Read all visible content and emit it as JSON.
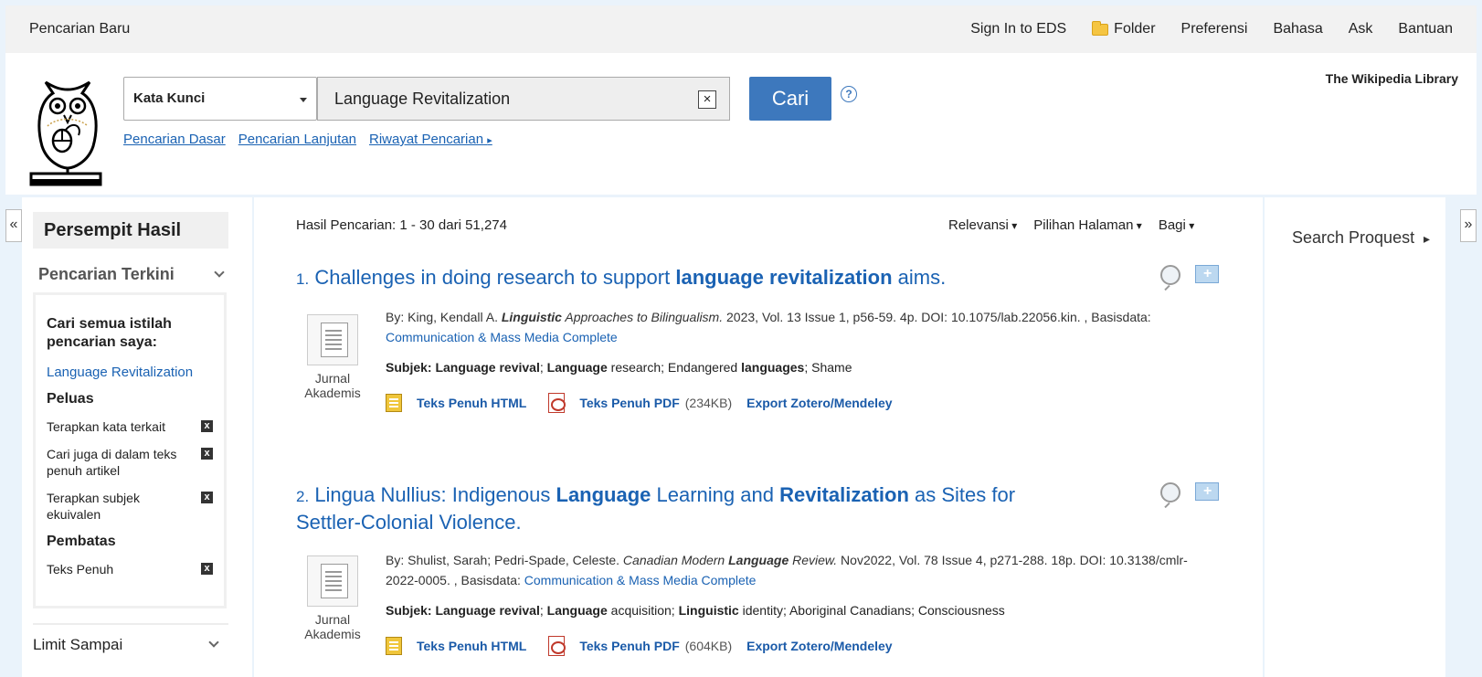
{
  "topbar": {
    "new_search": "Pencarian Baru",
    "sign_in": "Sign In to EDS",
    "folder": "Folder",
    "preferences": "Preferensi",
    "language": "Bahasa",
    "ask": "Ask",
    "help": "Bantuan"
  },
  "header": {
    "field_select": "Kata Kunci",
    "query": "Language Revitalization",
    "clear_icon": "close-icon",
    "search_button": "Cari",
    "help_icon": "?",
    "links": [
      "Pencarian Dasar",
      "Pencarian Lanjutan",
      "Riwayat Pencarian"
    ],
    "institution": "The Wikipedia Library"
  },
  "sidebar": {
    "collapse": "«",
    "title": "Persempit Hasil",
    "recent": "Pencarian Terkini",
    "search_all": "Cari semua istilah pencarian saya:",
    "recent_term": "Language Revitalization",
    "expanders_title": "Peluas",
    "expanders": [
      "Terapkan kata terkait",
      "Cari juga di dalam teks penuh artikel",
      "Terapkan subjek ekuivalen"
    ],
    "limiters_title": "Pembatas",
    "limiters": [
      "Teks Penuh"
    ],
    "remove_icon": "x",
    "limit_to": "Limit Sampai"
  },
  "results": {
    "count": "Hasil Pencarian: 1 - 30 dari 51,274",
    "sort": "Relevansi",
    "page_options": "Pilihan Halaman",
    "share": "Bagi",
    "items": [
      {
        "num": "1.",
        "title_a": "Challenges in doing research to support ",
        "title_b": "language revitalization",
        "title_c": " aims.",
        "by": "By: King, Kendall A. ",
        "src_b": "Linguistic",
        "src_rest": " Approaches to Bilingualism.",
        "details": " 2023, Vol. 13 Issue 1, p56-59. 4p. DOI: 10.1075/lab.22056.kin. , Basisdata: ",
        "db": "Communication & Mass Media Complete",
        "subj_label": "Subjek: ",
        "subjects": [
          {
            "b": "Language revival",
            "t": "; "
          },
          {
            "b": "Language",
            "t": " research; Endangered "
          },
          {
            "b": "languages",
            "t": "; Shame"
          }
        ],
        "type": "Jurnal Akademis",
        "html_link": "Teks Penuh HTML",
        "pdf_link": "Teks Penuh PDF",
        "pdf_size": "(234KB)",
        "export": "Export Zotero/Mendeley"
      },
      {
        "num": "2.",
        "title_parts": [
          {
            "b": false,
            "t": "Lingua Nullius: Indigenous "
          },
          {
            "b": true,
            "t": "Language"
          },
          {
            "b": false,
            "t": " Learning and "
          },
          {
            "b": true,
            "t": "Revitalization"
          },
          {
            "b": false,
            "t": " as Sites for Settler-Colonial Violence."
          }
        ],
        "by": "By: Shulist, Sarah; Pedri-Spade, Celeste. ",
        "src_a": "Canadian Modern ",
        "src_b": "Language",
        "src_c": " Review.",
        "details": " Nov2022, Vol. 78 Issue 4, p271-288. 18p. DOI: 10.3138/cmlr-2022-0005. , Basisdata: ",
        "db": "Communication & Mass Media Complete",
        "subj_label": "Subjek: ",
        "subjects": [
          {
            "b": "Language revival",
            "t": "; "
          },
          {
            "b": "Language",
            "t": " acquisition; "
          },
          {
            "b": "Linguistic",
            "t": " identity; Aboriginal Canadians; Consciousness"
          }
        ],
        "type": "Jurnal Akademis",
        "html_link": "Teks Penuh HTML",
        "pdf_link": "Teks Penuh PDF",
        "pdf_size": "(604KB)",
        "export": "Export Zotero/Mendeley"
      }
    ]
  },
  "right_panel": {
    "proquest": "Search Proquest",
    "expand": "»"
  }
}
